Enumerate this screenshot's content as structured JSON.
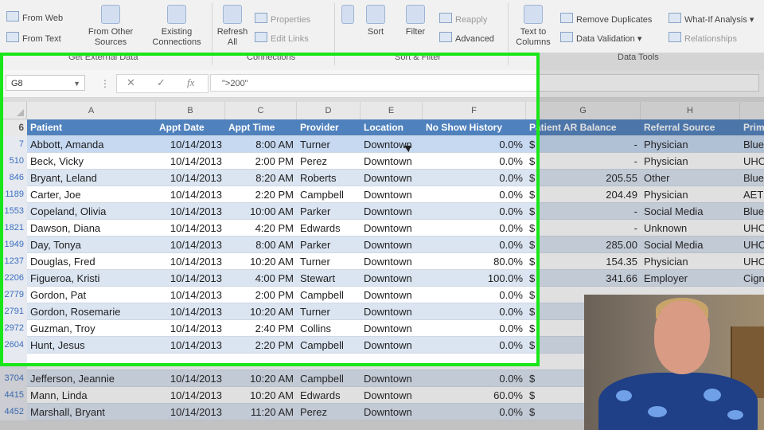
{
  "ribbon": {
    "small_left": [
      "From Web",
      "From Text"
    ],
    "from_other_sources": "From Other Sources",
    "existing_connections": "Existing Connections",
    "refresh_all": "Refresh All",
    "properties": "Properties",
    "edit_links": "Edit Links",
    "sort": "Sort",
    "filter": "Filter",
    "reapply": "Reapply",
    "advanced": "Advanced",
    "text_to_columns": "Text to Columns",
    "remove_duplicates": "Remove Duplicates",
    "data_validation": "Data Validation",
    "what_if": "What-If Analysis",
    "relationships": "Relationships",
    "groups": {
      "get_external": "Get External Data",
      "connections": "Connections",
      "sort_filter": "Sort & Filter",
      "data_tools": "Data Tools"
    }
  },
  "formula_bar": {
    "name_box": "G8",
    "formula": "\">200\""
  },
  "columns": [
    "A",
    "B",
    "C",
    "D",
    "E",
    "F",
    "G",
    "H"
  ],
  "table": {
    "header_row_number": "6",
    "headers": [
      "Patient",
      "Appt Date",
      "Appt Time",
      "Provider",
      "Location",
      "No Show History",
      "Patient AR Balance",
      "Referral Source",
      "Prim"
    ],
    "rows": [
      {
        "n": "7",
        "patient": "Abbott, Amanda",
        "date": "10/14/2013",
        "time": "8:00 AM",
        "provider": "Turner",
        "location": "Downtown",
        "noshow": "0.0%",
        "bal_sym": "$",
        "bal": "-",
        "ref": "Physician",
        "prim": "Blue"
      },
      {
        "n": "510",
        "patient": "Beck, Vicky",
        "date": "10/14/2013",
        "time": "2:00 PM",
        "provider": "Perez",
        "location": "Downtown",
        "noshow": "0.0%",
        "bal_sym": "$",
        "bal": "-",
        "ref": "Physician",
        "prim": "UHC"
      },
      {
        "n": "846",
        "patient": "Bryant, Leland",
        "date": "10/14/2013",
        "time": "8:20 AM",
        "provider": "Roberts",
        "location": "Downtown",
        "noshow": "0.0%",
        "bal_sym": "$",
        "bal": "205.55",
        "ref": "Other",
        "prim": "Blue"
      },
      {
        "n": "1189",
        "patient": "Carter, Joe",
        "date": "10/14/2013",
        "time": "2:20 PM",
        "provider": "Campbell",
        "location": "Downtown",
        "noshow": "0.0%",
        "bal_sym": "$",
        "bal": "204.49",
        "ref": "Physician",
        "prim": "AETN"
      },
      {
        "n": "1553",
        "patient": "Copeland, Olivia",
        "date": "10/14/2013",
        "time": "10:00 AM",
        "provider": "Parker",
        "location": "Downtown",
        "noshow": "0.0%",
        "bal_sym": "$",
        "bal": "-",
        "ref": "Social Media",
        "prim": "Blue"
      },
      {
        "n": "1821",
        "patient": "Dawson, Diana",
        "date": "10/14/2013",
        "time": "4:20 PM",
        "provider": "Edwards",
        "location": "Downtown",
        "noshow": "0.0%",
        "bal_sym": "$",
        "bal": "-",
        "ref": "Unknown",
        "prim": "UHC"
      },
      {
        "n": "1949",
        "patient": "Day, Tonya",
        "date": "10/14/2013",
        "time": "8:00 AM",
        "provider": "Parker",
        "location": "Downtown",
        "noshow": "0.0%",
        "bal_sym": "$",
        "bal": "285.00",
        "ref": "Social Media",
        "prim": "UHC"
      },
      {
        "n": "1237",
        "patient": "Douglas, Fred",
        "date": "10/14/2013",
        "time": "10:20 AM",
        "provider": "Turner",
        "location": "Downtown",
        "noshow": "80.0%",
        "bal_sym": "$",
        "bal": "154.35",
        "ref": "Physician",
        "prim": "UHC"
      },
      {
        "n": "2206",
        "patient": "Figueroa, Kristi",
        "date": "10/14/2013",
        "time": "4:00 PM",
        "provider": "Stewart",
        "location": "Downtown",
        "noshow": "100.0%",
        "bal_sym": "$",
        "bal": "341.66",
        "ref": "Employer",
        "prim": "Cign"
      },
      {
        "n": "2779",
        "patient": "Gordon, Pat",
        "date": "10/14/2013",
        "time": "2:00 PM",
        "provider": "Campbell",
        "location": "Downtown",
        "noshow": "0.0%",
        "bal_sym": "$",
        "bal": "",
        "ref": "",
        "prim": ""
      },
      {
        "n": "2791",
        "patient": "Gordon, Rosemarie",
        "date": "10/14/2013",
        "time": "10:20 AM",
        "provider": "Turner",
        "location": "Downtown",
        "noshow": "0.0%",
        "bal_sym": "$",
        "bal": "",
        "ref": "",
        "prim": ""
      },
      {
        "n": "2972",
        "patient": "Guzman, Troy",
        "date": "10/14/2013",
        "time": "2:40 PM",
        "provider": "Collins",
        "location": "Downtown",
        "noshow": "0.0%",
        "bal_sym": "$",
        "bal": "",
        "ref": "",
        "prim": ""
      },
      {
        "n": "2604",
        "patient": "Hunt, Jesus",
        "date": "10/14/2013",
        "time": "2:20 PM",
        "provider": "Campbell",
        "location": "Downtown",
        "noshow": "0.0%",
        "bal_sym": "$",
        "bal": "",
        "ref": "",
        "prim": ""
      },
      {
        "n": "",
        "patient": "",
        "date": "",
        "time": "",
        "provider": "",
        "location": "",
        "noshow": "",
        "bal_sym": "",
        "bal": "",
        "ref": "",
        "prim": ""
      },
      {
        "n": "3704",
        "patient": "Jefferson, Jeannie",
        "date": "10/14/2013",
        "time": "10:20 AM",
        "provider": "Campbell",
        "location": "Downtown",
        "noshow": "0.0%",
        "bal_sym": "$",
        "bal": "",
        "ref": "",
        "prim": ""
      },
      {
        "n": "4415",
        "patient": "Mann, Linda",
        "date": "10/14/2013",
        "time": "10:20 AM",
        "provider": "Edwards",
        "location": "Downtown",
        "noshow": "60.0%",
        "bal_sym": "$",
        "bal": "",
        "ref": "",
        "prim": ""
      },
      {
        "n": "4452",
        "patient": "Marshall, Bryant",
        "date": "10/14/2013",
        "time": "11:20 AM",
        "provider": "Perez",
        "location": "Downtown",
        "noshow": "0.0%",
        "bal_sym": "$",
        "bal": "",
        "ref": "",
        "prim": ""
      }
    ]
  },
  "colors": {
    "header_blue": "#4f81bd",
    "band_blue": "#dbe5f1",
    "highlight_frame": "#19e619"
  }
}
